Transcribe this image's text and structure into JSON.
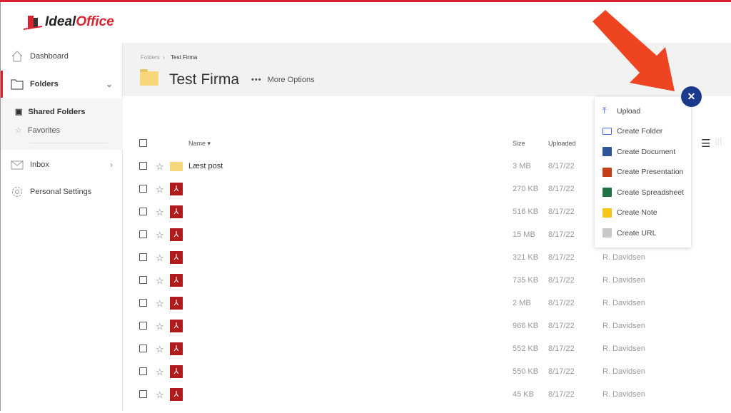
{
  "brand": {
    "logo_text": "IdealOffice",
    "accent": "#d8232f"
  },
  "sidebar": {
    "items": [
      {
        "label": "Dashboard",
        "icon": "home-icon"
      },
      {
        "label": "Folders",
        "icon": "folder-icon"
      },
      {
        "label": "Inbox",
        "icon": "mail-icon"
      },
      {
        "label": "Personal Settings",
        "icon": "gear-icon"
      }
    ],
    "sub_items": [
      {
        "label": "Shared Folders",
        "icon": "shared-folder-icon"
      },
      {
        "label": "Favorites",
        "icon": "star-icon"
      }
    ]
  },
  "breadcrumb": {
    "root": "Folders",
    "current": "Test Firma"
  },
  "page": {
    "title": "Test Firma",
    "more_options": "More Options"
  },
  "table": {
    "headers": {
      "name": "Name",
      "size": "Size",
      "uploaded": "Uploaded"
    },
    "rows": [
      {
        "type": "folder",
        "name": "Læst post",
        "size": "3 MB",
        "date": "8/17/22",
        "uploader": ""
      },
      {
        "type": "pdf",
        "name": "",
        "size": "270 KB",
        "date": "8/17/22",
        "uploader": ""
      },
      {
        "type": "pdf",
        "name": "",
        "size": "516 KB",
        "date": "8/17/22",
        "uploader": ""
      },
      {
        "type": "pdf",
        "name": "",
        "size": "15 MB",
        "date": "8/17/22",
        "uploader": ""
      },
      {
        "type": "pdf",
        "name": "",
        "size": "321 KB",
        "date": "8/17/22",
        "uploader": "R. Davidsen"
      },
      {
        "type": "pdf",
        "name": "",
        "size": "735 KB",
        "date": "8/17/22",
        "uploader": "R. Davidsen"
      },
      {
        "type": "pdf",
        "name": "",
        "size": "2 MB",
        "date": "8/17/22",
        "uploader": "R. Davidsen"
      },
      {
        "type": "pdf",
        "name": "",
        "size": "966 KB",
        "date": "8/17/22",
        "uploader": "R. Davidsen"
      },
      {
        "type": "pdf",
        "name": "",
        "size": "552 KB",
        "date": "8/17/22",
        "uploader": "R. Davidsen"
      },
      {
        "type": "pdf",
        "name": "",
        "size": "550 KB",
        "date": "8/17/22",
        "uploader": "R. Davidsen"
      },
      {
        "type": "pdf",
        "name": "",
        "size": "45 KB",
        "date": "8/17/22",
        "uploader": "R. Davidsen"
      }
    ]
  },
  "menu": {
    "items": [
      {
        "label": "Upload",
        "icon": "upload-icon",
        "color": "#3b5bdb"
      },
      {
        "label": "Create Folder",
        "icon": "folder-outline-icon",
        "color": "#4c6ef5"
      },
      {
        "label": "Create Document",
        "icon": "document-icon",
        "color": "#2f5597"
      },
      {
        "label": "Create Presentation",
        "icon": "presentation-icon",
        "color": "#c43e1c"
      },
      {
        "label": "Create Spreadsheet",
        "icon": "spreadsheet-icon",
        "color": "#217346"
      },
      {
        "label": "Create Note",
        "icon": "note-icon",
        "color": "#f5c518"
      },
      {
        "label": "Create URL",
        "icon": "link-icon",
        "color": "#c8c8c8"
      }
    ]
  },
  "annotation": {
    "arrow_color": "#ee4422"
  }
}
